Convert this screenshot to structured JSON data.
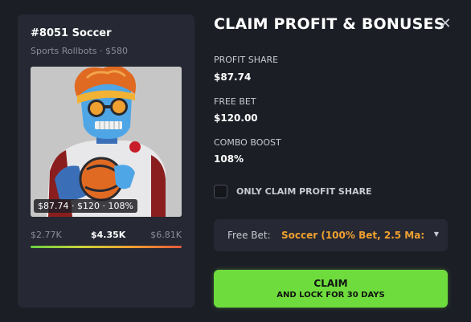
{
  "nft": {
    "title": "#8051 Soccer",
    "subtitle": "Sports Rollbots · $580",
    "image_badge": "$87.74 · $120 · 108%",
    "range": {
      "min": "$2.77K",
      "current": "$4.35K",
      "max": "$6.81K"
    }
  },
  "panel": {
    "title": "CLAIM PROFIT & BONUSES",
    "close_icon": "close-icon",
    "stats": [
      {
        "label": "PROFIT SHARE",
        "value": "$87.74"
      },
      {
        "label": "FREE BET",
        "value": "$120.00"
      },
      {
        "label": "COMBO BOOST",
        "value": "108%"
      }
    ],
    "checkbox_label": "ONLY CLAIM PROFIT SHARE",
    "dropdown": {
      "label": "Free Bet:",
      "value": "Soccer (100% Bet, 2.5 Ma:"
    },
    "claim": {
      "main": "CLAIM",
      "sub": "AND LOCK FOR 30 DAYS"
    }
  },
  "colors": {
    "background": "#1c1e26",
    "card": "#262833",
    "accent_green": "#6fdc3e",
    "accent_orange": "#f0a030"
  }
}
